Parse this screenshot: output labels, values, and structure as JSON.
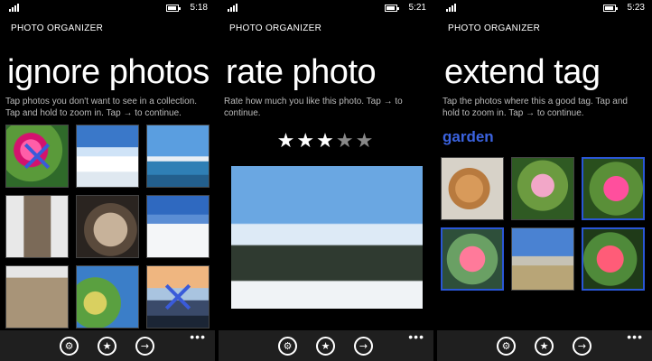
{
  "screens": [
    {
      "time": "5:18",
      "app_title": "PHOTO ORGANIZER",
      "page_title": "ignore photos",
      "instructions": "Tap photos you don't want to see in a collection. Tap and hold to zoom in. Tap → to continue."
    },
    {
      "time": "5:21",
      "app_title": "PHOTO ORGANIZER",
      "page_title": "rate photo",
      "instructions": "Rate how much you like this photo. Tap → to continue.",
      "rating": 3,
      "rating_max": 5
    },
    {
      "time": "5:23",
      "app_title": "PHOTO ORGANIZER",
      "page_title": "extend tag",
      "instructions": "Tap the photos where this a good tag. Tap and hold to zoom in. Tap → to continue.",
      "tag": "garden"
    }
  ],
  "app_bar": {
    "settings_icon": "⚙",
    "star_icon": "★",
    "arrow_icon": "→",
    "more": "•••"
  },
  "colors": {
    "accent": "#2a56d6",
    "tag_label": "#3b63e0",
    "background": "#000000",
    "app_bar": "#1f1f1f"
  }
}
